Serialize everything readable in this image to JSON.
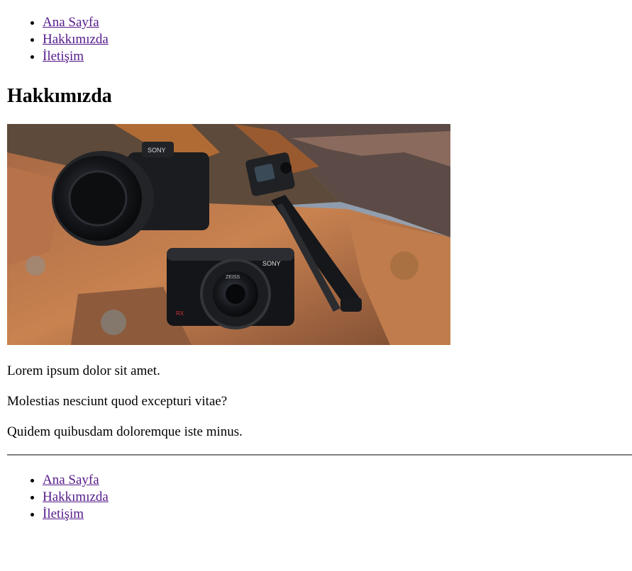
{
  "nav_top": [
    {
      "label": "Ana Sayfa"
    },
    {
      "label": "Hakkımızda"
    },
    {
      "label": "İletişim"
    }
  ],
  "page_title": "Hakkımızda",
  "hero_image": {
    "alt": "",
    "camera_brand": "SONY",
    "lens_brand": "ZEISS",
    "model_badge": "RX"
  },
  "paragraphs": [
    "Lorem ipsum dolor sit amet.",
    "Molestias nesciunt quod excepturi vitae?",
    "Quidem quibusdam doloremque iste minus."
  ],
  "nav_bottom": [
    {
      "label": "Ana Sayfa"
    },
    {
      "label": "Hakkımızda"
    },
    {
      "label": "İletişim"
    }
  ],
  "colors": {
    "link_visited": "#551a8b",
    "divider": "#808080"
  }
}
